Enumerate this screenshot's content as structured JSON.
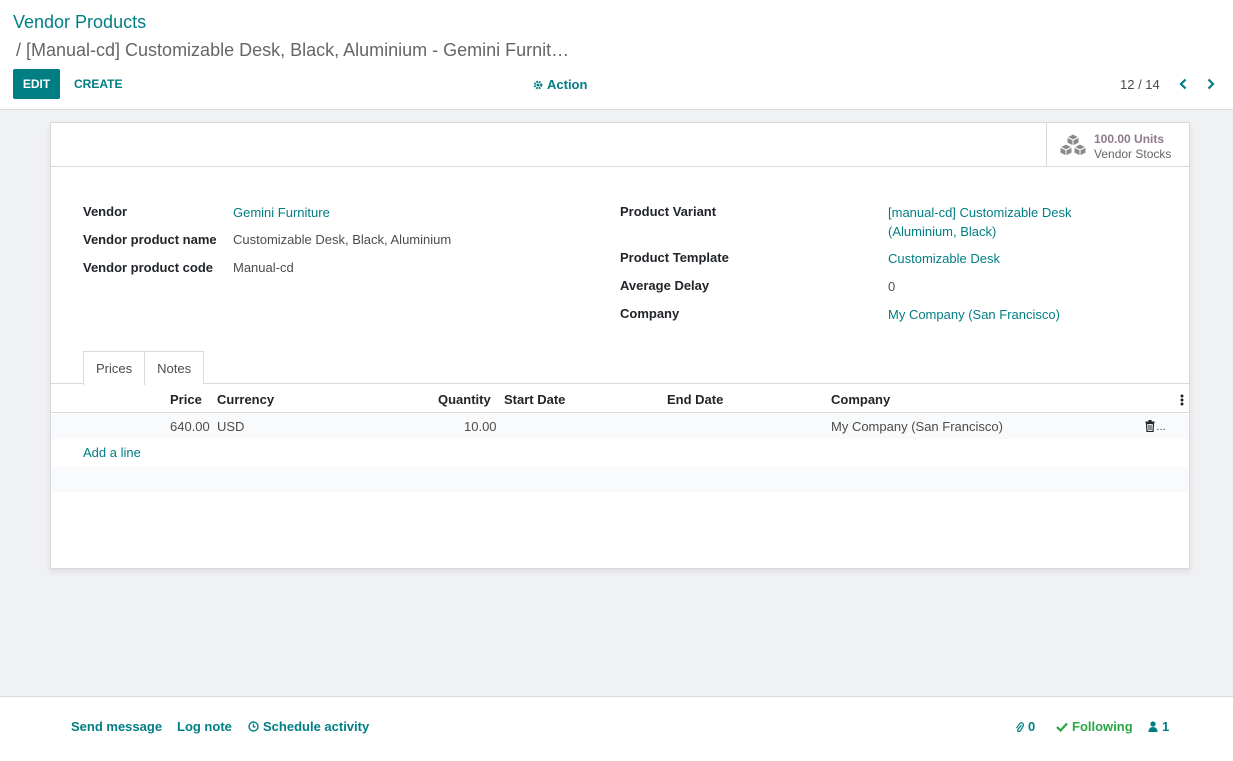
{
  "breadcrumb": {
    "root": "Vendor Products",
    "current": "/ [Manual-cd] Customizable Desk, Black, Aluminium - Gemini Furnit…"
  },
  "toolbar": {
    "edit_label": "EDIT",
    "create_label": "CREATE",
    "action_label": "Action"
  },
  "pager": {
    "value": "12 / 14"
  },
  "stat_button": {
    "value": "100.00 Units",
    "label": "Vendor Stocks"
  },
  "fields_left": [
    {
      "label": "Vendor",
      "value": "Gemini Furniture",
      "link": true
    },
    {
      "label": "Vendor product name",
      "value": "Customizable Desk, Black, Aluminium",
      "link": false
    },
    {
      "label": "Vendor product code",
      "value": "Manual-cd",
      "link": false
    }
  ],
  "fields_right": [
    {
      "label": "Product Variant",
      "value_line1": "[manual-cd] Customizable Desk",
      "value_line2": "(Aluminium, Black)",
      "link": true
    },
    {
      "label": "Product Template",
      "value": "Customizable Desk",
      "link": true
    },
    {
      "label": "Average Delay",
      "value": "0",
      "link": false
    },
    {
      "label": "Company",
      "value": "My Company (San Francisco)",
      "link": true
    }
  ],
  "tabs": [
    {
      "label": "Prices",
      "active": true
    },
    {
      "label": "Notes",
      "active": false
    }
  ],
  "table": {
    "columns": [
      "Price",
      "Currency",
      "Quantity",
      "Start Date",
      "End Date",
      "Company"
    ],
    "rows": [
      {
        "price": "640.00",
        "currency": "USD",
        "quantity": "10.00",
        "start_date": "",
        "end_date": "",
        "company": "My Company (San Francisco)"
      }
    ],
    "add_line_label": "Add a line"
  },
  "chatter": {
    "send_message": "Send message",
    "log_note": "Log note",
    "schedule_activity": "Schedule activity",
    "attachments_count": "0",
    "following_label": "Following",
    "followers_count": "1"
  },
  "colors": {
    "accent": "#017e84",
    "following": "#28a745",
    "stat_value": "#8f7a8b"
  }
}
